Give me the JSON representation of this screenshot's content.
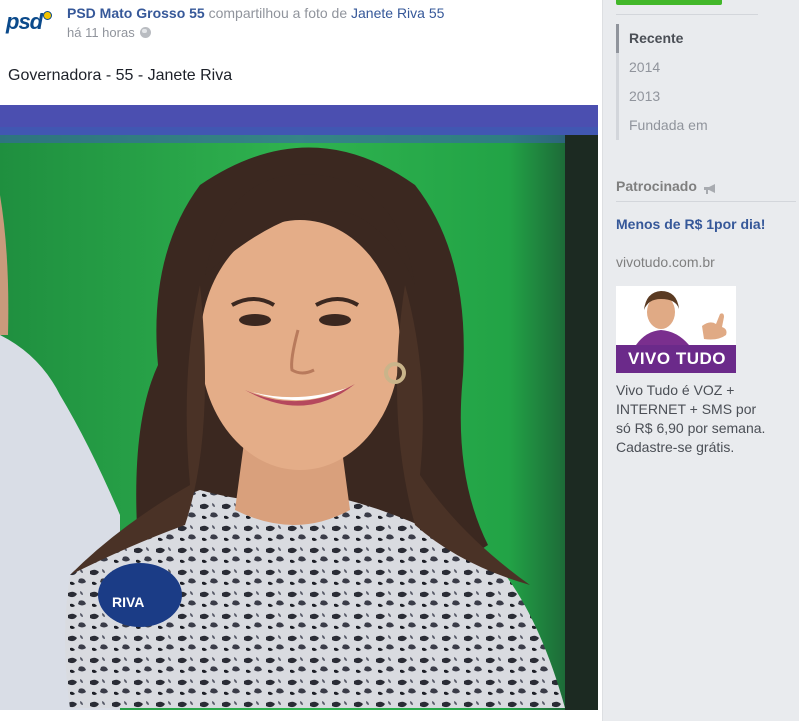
{
  "post": {
    "page_name": "PSD Mato Grosso 55",
    "action_text": "compartilhou a foto de",
    "shared_from": "Janete Riva 55",
    "timestamp": "há 11 horas",
    "message": "Governadora - 55 - Janete Riva",
    "logo_text": "psd",
    "photo": {
      "icon": "portrait-photo",
      "badge_text": "RIVA"
    }
  },
  "timeline_nav": {
    "items": [
      {
        "label": "Recente",
        "active": true
      },
      {
        "label": "2014",
        "active": false
      },
      {
        "label": "2013",
        "active": false
      },
      {
        "label": "Fundada em",
        "active": false
      }
    ]
  },
  "sponsored": {
    "heading": "Patrocinado",
    "ad": {
      "title": "Menos de R$ 1por dia!",
      "domain": "vivotudo.com.br",
      "brand": "VIVO TUDO",
      "body": "Vivo Tudo é VOZ + INTERNET + SMS por só R$ 6,90 por semana. Cadastre-se grátis."
    }
  },
  "colors": {
    "link_blue": "#365899",
    "meta_gray": "#90949c",
    "brand_purple": "#6b2a8a",
    "action_green": "#42b72a"
  }
}
